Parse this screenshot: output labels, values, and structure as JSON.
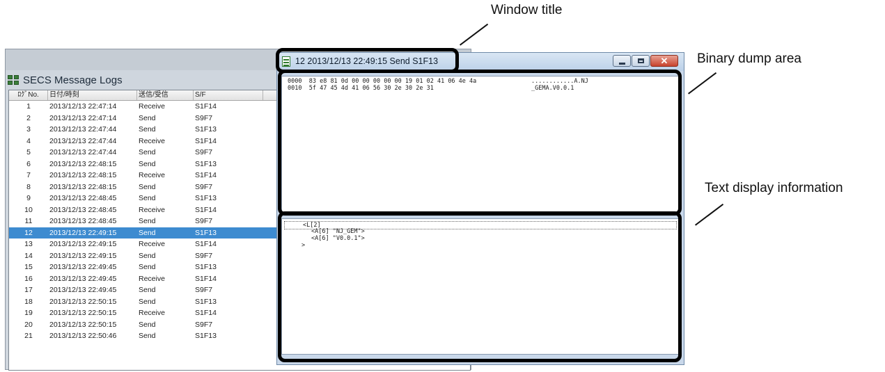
{
  "callouts": {
    "window_title": "Window title",
    "binary_dump_area": "Binary dump area",
    "text_display_information": "Text display information"
  },
  "log_window": {
    "title": "SECS Message Logs",
    "columns": [
      "ﾛｸﾞNo.",
      "日付/時刻",
      "送信/受信",
      "S/F"
    ],
    "selected_row": 12,
    "rows": [
      {
        "no": "1",
        "datetime": "2013/12/13 22:47:14",
        "dir": "Receive",
        "sf": "S1F14"
      },
      {
        "no": "2",
        "datetime": "2013/12/13 22:47:14",
        "dir": "Send",
        "sf": "S9F7"
      },
      {
        "no": "3",
        "datetime": "2013/12/13 22:47:44",
        "dir": "Send",
        "sf": "S1F13"
      },
      {
        "no": "4",
        "datetime": "2013/12/13 22:47:44",
        "dir": "Receive",
        "sf": "S1F14"
      },
      {
        "no": "5",
        "datetime": "2013/12/13 22:47:44",
        "dir": "Send",
        "sf": "S9F7"
      },
      {
        "no": "6",
        "datetime": "2013/12/13 22:48:15",
        "dir": "Send",
        "sf": "S1F13"
      },
      {
        "no": "7",
        "datetime": "2013/12/13 22:48:15",
        "dir": "Receive",
        "sf": "S1F14"
      },
      {
        "no": "8",
        "datetime": "2013/12/13 22:48:15",
        "dir": "Send",
        "sf": "S9F7"
      },
      {
        "no": "9",
        "datetime": "2013/12/13 22:48:45",
        "dir": "Send",
        "sf": "S1F13"
      },
      {
        "no": "10",
        "datetime": "2013/12/13 22:48:45",
        "dir": "Receive",
        "sf": "S1F14"
      },
      {
        "no": "11",
        "datetime": "2013/12/13 22:48:45",
        "dir": "Send",
        "sf": "S9F7"
      },
      {
        "no": "12",
        "datetime": "2013/12/13 22:49:15",
        "dir": "Send",
        "sf": "S1F13"
      },
      {
        "no": "13",
        "datetime": "2013/12/13 22:49:15",
        "dir": "Receive",
        "sf": "S1F14"
      },
      {
        "no": "14",
        "datetime": "2013/12/13 22:49:15",
        "dir": "Send",
        "sf": "S9F7"
      },
      {
        "no": "15",
        "datetime": "2013/12/13 22:49:45",
        "dir": "Send",
        "sf": "S1F13"
      },
      {
        "no": "16",
        "datetime": "2013/12/13 22:49:45",
        "dir": "Receive",
        "sf": "S1F14"
      },
      {
        "no": "17",
        "datetime": "2013/12/13 22:49:45",
        "dir": "Send",
        "sf": "S9F7"
      },
      {
        "no": "18",
        "datetime": "2013/12/13 22:50:15",
        "dir": "Send",
        "sf": "S1F13"
      },
      {
        "no": "19",
        "datetime": "2013/12/13 22:50:15",
        "dir": "Receive",
        "sf": "S1F14"
      },
      {
        "no": "20",
        "datetime": "2013/12/13 22:50:15",
        "dir": "Send",
        "sf": "S9F7"
      },
      {
        "no": "21",
        "datetime": "2013/12/13 22:50:46",
        "dir": "Send",
        "sf": "S1F13"
      }
    ]
  },
  "detail_window": {
    "title": "12 2013/12/13 22:49:15 Send S1F13",
    "close_glyph": "✕",
    "binary_dump": [
      {
        "offset": "0000",
        "hex": "83 e8 81 0d 00 00 00 00 00 19 01 02 41 06 4e 4a",
        "ascii": "............A.NJ"
      },
      {
        "offset": "0010",
        "hex": "5f 47 45 4d 41 06 56 30 2e 30 2e 31",
        "ascii": "_GEMA.V0.0.1"
      }
    ],
    "text_lines": [
      "<L[2]",
      "<A[6] \"NJ_GEM\">",
      "<A[6] \"V0.0.1\">",
      ">"
    ]
  },
  "icons": {
    "log_window_icon": "grid-icon",
    "detail_window_icon": "document-icon"
  }
}
